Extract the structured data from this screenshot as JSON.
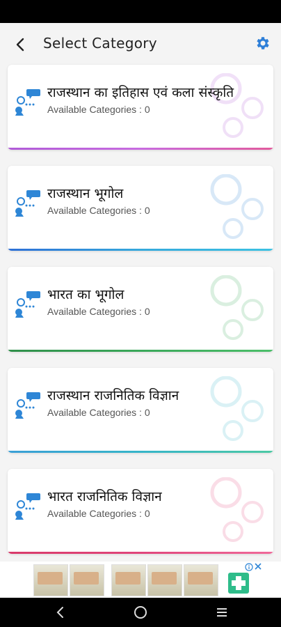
{
  "header": {
    "title": "Select Category"
  },
  "categories": [
    {
      "name": "राजस्थान का इतिहास एवं कला संस्कृति",
      "subtitle": "Available Categories : 0",
      "accent": "#b05ad8"
    },
    {
      "name": "राजस्थान भूगोल",
      "subtitle": "Available Categories : 0",
      "accent": "#2e86d6"
    },
    {
      "name": "भारत का भूगोल",
      "subtitle": "Available Categories : 0",
      "accent": "#3aa85a"
    },
    {
      "name": "राजस्थान राजनितिक विज्ञान",
      "subtitle": "Available Categories : 0",
      "accent": "#36b5c9"
    },
    {
      "name": "भारत राजनितिक विज्ञान",
      "subtitle": "Available Categories : 0",
      "accent": "#e0457b"
    }
  ],
  "colors": {
    "gear": "#2e7fd8",
    "icon_blue": "#2e86d6"
  },
  "icons": {
    "back": "chevron-left-icon",
    "settings": "gear-icon",
    "category": "quiz-category-icon",
    "nav_back": "nav-back-icon",
    "nav_home": "nav-home-icon",
    "nav_recents": "nav-recents-icon"
  }
}
